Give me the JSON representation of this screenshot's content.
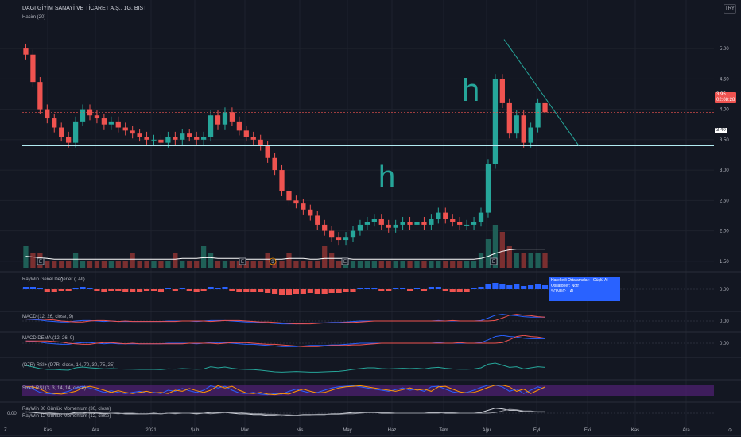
{
  "symbol_title": "DAGI GİYİM SANAYİ VE TİCARET A.Ş., 1G, BIST",
  "volume_label": "Hacim (20)",
  "currency": "TRY",
  "last_price": "3.95",
  "last_time": "02:08:28",
  "support_price": "3.40",
  "indicators": {
    "raywin_general": "RayWin Genel Değerler (, All)",
    "macd": "MACD (12, 26, close, 9)",
    "macd_dema": "MACD DEMA (12, 26, 9)",
    "rsi": "(D7R) RSI+ (D7R, close, 14, 70, 30, 75, 25)",
    "stoch_rsi": "Stoch RSI (3, 3, 14, 14, close)",
    "momentum_1": "RayWin 30 Günlük Momentum (30, close)",
    "momentum_2": "RayWin 12 Günlük Momentum (12, close)"
  },
  "tooltip": {
    "row1_label": "Hareketli Ortalamalar:",
    "row1_value": "Güçlü Al",
    "row2_label": "Osilatörler:",
    "row2_value": "Nötr",
    "row3_label": "SONUÇ:",
    "row3_value": "Al"
  },
  "annotations": {
    "h1": "h",
    "h2": "h"
  },
  "earnings_markers": [
    "E",
    "E",
    "E",
    "E"
  ],
  "dividend_marker": "$",
  "left_scale_value": "0.00",
  "bottom_left_marker": "Z",
  "bottom_right_marker": "⊙",
  "colors": {
    "up": "#26a69a",
    "down": "#ef5350",
    "accent": "#2962ff",
    "bg": "#131722"
  },
  "chart_data": {
    "type": "candlestick",
    "x_ticks": [
      "Kas",
      "Ara",
      "2021",
      "Şub",
      "Mar",
      "Nis",
      "May",
      "Haz",
      "Tem",
      "Ağu",
      "Eyl",
      "Eki",
      "Kas",
      "Ara"
    ],
    "price_ticks": [
      "5.00",
      "4.50",
      "4.00",
      "3.50",
      "3.00",
      "2.50",
      "2.00",
      "1.50"
    ],
    "ylim": [
      1.38,
      5.38
    ],
    "horizontal_support": 3.4,
    "price_series": [
      4.9,
      4.45,
      4.0,
      3.85,
      3.7,
      3.55,
      3.45,
      3.8,
      4.0,
      3.9,
      3.85,
      3.75,
      3.8,
      3.7,
      3.65,
      3.6,
      3.55,
      3.5,
      3.5,
      3.45,
      3.55,
      3.5,
      3.6,
      3.55,
      3.5,
      3.55,
      3.9,
      3.75,
      3.95,
      3.8,
      3.65,
      3.55,
      3.5,
      3.4,
      3.2,
      3.0,
      2.65,
      2.5,
      2.45,
      2.35,
      2.25,
      2.1,
      2.0,
      1.9,
      1.85,
      1.9,
      2.0,
      2.1,
      2.15,
      2.2,
      2.1,
      2.05,
      2.1,
      2.15,
      2.1,
      2.15,
      2.1,
      2.2,
      2.3,
      2.2,
      2.15,
      2.1,
      2.1,
      2.15,
      2.3,
      3.1,
      4.5,
      4.1,
      3.6,
      3.9,
      3.45,
      3.7,
      4.1,
      3.95
    ],
    "volume_series": [
      3,
      2,
      2,
      1,
      1,
      1,
      1,
      2,
      1,
      1,
      1,
      1,
      1,
      1,
      1,
      2,
      1,
      1,
      1,
      1,
      1,
      2,
      1,
      1,
      1,
      3,
      2,
      1,
      1,
      1,
      1,
      1,
      1,
      1,
      2,
      1,
      1,
      2,
      1,
      1,
      1,
      1,
      3,
      2,
      1,
      1,
      1,
      1,
      1,
      1,
      1,
      1,
      1,
      1,
      1,
      1,
      1,
      1,
      1,
      1,
      1,
      1,
      1,
      1,
      2,
      4,
      6,
      5,
      3,
      2,
      2,
      2,
      2,
      2
    ],
    "volume_ma": [
      1.6,
      1.5,
      1.4,
      1.3,
      1.2,
      1.2,
      1.2,
      1.2,
      1.2,
      1.2,
      1.2,
      1.2,
      1.2,
      1.2,
      1.2,
      1.2,
      1.2,
      1.2,
      1.2,
      1.2,
      1.2,
      1.2,
      1.3,
      1.3,
      1.3,
      1.4,
      1.4,
      1.3,
      1.3,
      1.3,
      1.3,
      1.2,
      1.2,
      1.2,
      1.2,
      1.2,
      1.2,
      1.3,
      1.3,
      1.3,
      1.2,
      1.2,
      1.3,
      1.3,
      1.3,
      1.3,
      1.2,
      1.2,
      1.2,
      1.2,
      1.2,
      1.2,
      1.2,
      1.2,
      1.2,
      1.2,
      1.2,
      1.2,
      1.2,
      1.2,
      1.2,
      1.2,
      1.2,
      1.2,
      1.3,
      1.6,
      2.0,
      2.3,
      2.5,
      2.6,
      2.6,
      2.6,
      2.6,
      2.6
    ],
    "raywin_series": [
      0.3,
      0.3,
      0.2,
      -0.3,
      -0.3,
      -0.2,
      -0.2,
      0.2,
      0.3,
      0.2,
      -0.2,
      -0.3,
      -0.2,
      -0.2,
      -0.3,
      -0.3,
      -0.3,
      -0.2,
      -0.2,
      -0.3,
      0.2,
      -0.2,
      0.2,
      -0.2,
      -0.3,
      -0.2,
      0.3,
      0.2,
      0.3,
      -0.2,
      -0.3,
      -0.3,
      -0.3,
      -0.4,
      -0.5,
      -0.6,
      -0.7,
      -0.7,
      -0.6,
      -0.6,
      -0.5,
      -0.6,
      -0.6,
      -0.5,
      -0.5,
      -0.4,
      -0.3,
      0.2,
      0.2,
      0.2,
      -0.2,
      -0.2,
      0.2,
      0.2,
      -0.2,
      0.2,
      -0.2,
      0.3,
      0.3,
      -0.2,
      -0.3,
      -0.3,
      -0.3,
      0.2,
      0.3,
      0.7,
      0.8,
      0.7,
      0.5,
      0.6,
      0.4,
      0.5,
      0.6,
      0.5
    ],
    "macd_series": [
      0.2,
      0.15,
      0.1,
      0.0,
      -0.05,
      -0.1,
      -0.1,
      0.0,
      0.05,
      0.05,
      0.0,
      -0.05,
      0.0,
      -0.05,
      -0.05,
      -0.05,
      -0.05,
      -0.05,
      -0.05,
      -0.05,
      0.0,
      0.0,
      0.0,
      0.0,
      -0.05,
      0.0,
      0.05,
      0.05,
      0.05,
      0.0,
      -0.05,
      -0.1,
      -0.1,
      -0.15,
      -0.2,
      -0.25,
      -0.3,
      -0.3,
      -0.3,
      -0.25,
      -0.2,
      -0.2,
      -0.2,
      -0.15,
      -0.15,
      -0.1,
      -0.05,
      0.0,
      0.0,
      0.0,
      0.0,
      0.0,
      0.0,
      0.0,
      0.0,
      0.0,
      0.0,
      0.0,
      0.05,
      0.0,
      0.0,
      0.0,
      0.0,
      0.0,
      0.05,
      0.3,
      0.6,
      0.7,
      0.6,
      0.55,
      0.45,
      0.4,
      0.4,
      0.4
    ],
    "rsi_series": [
      70,
      60,
      50,
      45,
      45,
      42,
      40,
      55,
      60,
      55,
      52,
      48,
      50,
      48,
      47,
      46,
      45,
      45,
      45,
      44,
      48,
      47,
      50,
      48,
      46,
      48,
      62,
      55,
      60,
      52,
      47,
      45,
      44,
      40,
      35,
      30,
      28,
      30,
      32,
      30,
      28,
      28,
      30,
      32,
      33,
      38,
      45,
      50,
      55,
      55,
      50,
      48,
      50,
      52,
      50,
      52,
      48,
      55,
      58,
      52,
      48,
      46,
      46,
      48,
      55,
      78,
      85,
      72,
      58,
      62,
      48,
      55,
      62,
      58
    ],
    "stoch_series": [
      80,
      60,
      30,
      20,
      15,
      25,
      40,
      70,
      85,
      70,
      50,
      30,
      45,
      30,
      20,
      30,
      40,
      25,
      30,
      20,
      50,
      40,
      65,
      45,
      30,
      50,
      90,
      70,
      85,
      50,
      25,
      20,
      30,
      15,
      10,
      20,
      15,
      40,
      60,
      40,
      25,
      30,
      50,
      70,
      80,
      85,
      90,
      80,
      70,
      60,
      50,
      40,
      55,
      70,
      50,
      60,
      40,
      80,
      85,
      60,
      35,
      25,
      30,
      50,
      75,
      95,
      95,
      80,
      40,
      60,
      20,
      50,
      80,
      60
    ],
    "momentum_series": [
      0.1,
      0.05,
      0.0,
      -0.05,
      -0.05,
      -0.05,
      -0.05,
      0.05,
      0.05,
      0.0,
      0.0,
      -0.05,
      0.0,
      0.0,
      -0.05,
      -0.05,
      -0.05,
      -0.05,
      0.0,
      -0.05,
      0.0,
      0.0,
      0.0,
      0.0,
      -0.05,
      0.0,
      0.05,
      0.05,
      0.05,
      0.0,
      -0.05,
      -0.05,
      -0.1,
      -0.1,
      -0.15,
      -0.15,
      -0.2,
      -0.15,
      -0.15,
      -0.1,
      -0.1,
      -0.1,
      -0.1,
      -0.05,
      -0.05,
      0.0,
      0.05,
      0.05,
      0.05,
      0.05,
      0.0,
      0.0,
      0.0,
      0.0,
      0.0,
      0.0,
      0.0,
      0.05,
      0.05,
      0.0,
      0.0,
      0.0,
      0.0,
      0.0,
      0.05,
      0.2,
      0.35,
      0.3,
      0.2,
      0.2,
      0.1,
      0.1,
      0.1,
      0.1
    ]
  }
}
